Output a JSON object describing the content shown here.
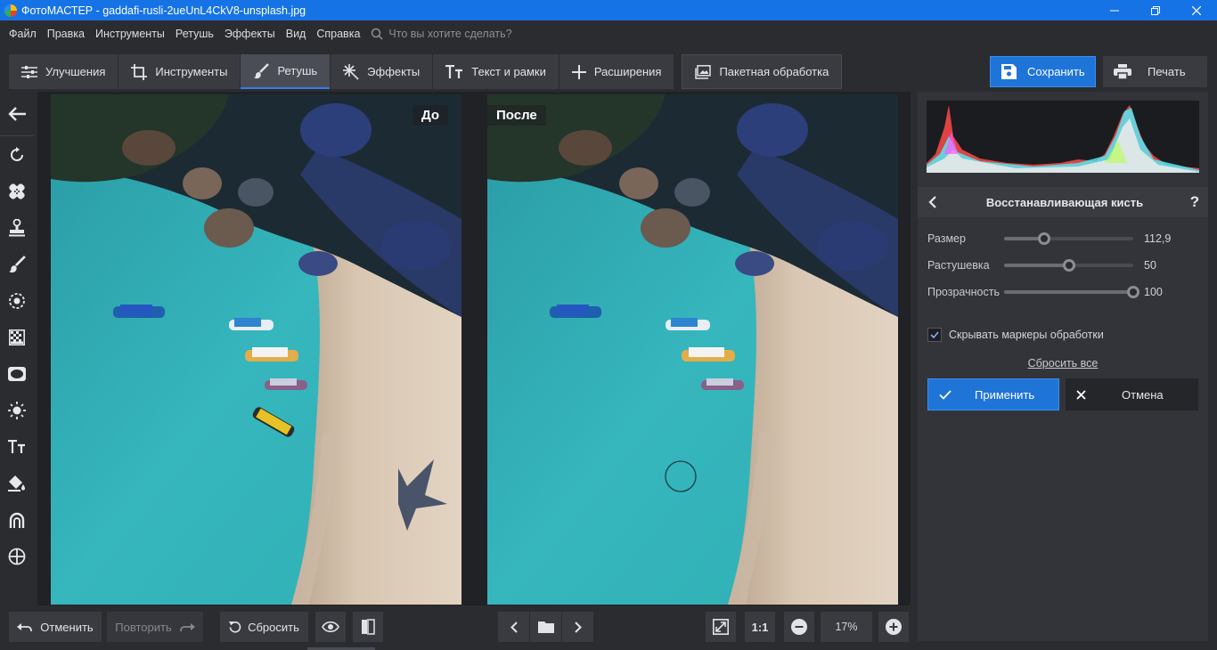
{
  "window": {
    "title": "ФотоМАСТЕР - gaddafi-rusli-2ueUnL4CkV8-unsplash.jpg",
    "controls": [
      "minimize-icon",
      "restore-icon",
      "close-icon"
    ]
  },
  "menu": {
    "items": [
      "Файл",
      "Правка",
      "Инструменты",
      "Ретушь",
      "Эффекты",
      "Вид",
      "Справка"
    ],
    "search_placeholder": "Что вы хотите сделать?"
  },
  "tabs": [
    {
      "label": "Улучшения",
      "icon": "sliders-icon"
    },
    {
      "label": "Инструменты",
      "icon": "crop-icon"
    },
    {
      "label": "Ретушь",
      "icon": "brush-icon",
      "active": true
    },
    {
      "label": "Эффекты",
      "icon": "sparkle-icon"
    },
    {
      "label": "Текст и рамки",
      "icon": "text-icon"
    },
    {
      "label": "Расширения",
      "icon": "plus-icon"
    },
    {
      "label": "Пакетная обработка",
      "icon": "images-icon"
    }
  ],
  "actions": {
    "save": "Сохранить",
    "print": "Печать"
  },
  "left_tools": [
    "back-arrow-icon",
    "rotate-icon",
    "healing-patch-icon",
    "stamp-icon",
    "brush-icon",
    "radial-icon",
    "grid-icon",
    "vignette-icon",
    "sun-icon",
    "text-tool-icon",
    "fill-icon",
    "tone-curve-icon",
    "target-icon"
  ],
  "preview": {
    "before_label": "До",
    "after_label": "После"
  },
  "panel": {
    "title": "Восстанавливающая кисть",
    "help": "?",
    "sliders": [
      {
        "label": "Размер",
        "value": "112,9",
        "fraction": 0.31
      },
      {
        "label": "Растушевка",
        "value": "50",
        "fraction": 0.5
      },
      {
        "label": "Прозрачность",
        "value": "100",
        "fraction": 1.0
      }
    ],
    "checkbox": {
      "label": "Скрывать маркеры обработки",
      "checked": true
    },
    "reset_all": "Сбросить все",
    "apply": "Применить",
    "cancel": "Отмена"
  },
  "bottom": {
    "undo": "Отменить",
    "redo": "Повторить",
    "reset": "Сбросить",
    "ratio": "1:1",
    "zoom": "17%"
  },
  "colors": {
    "accent": "#1f74d8",
    "titlebar": "#1673e6",
    "background": "#2b2c30",
    "panel": "#33343a"
  }
}
